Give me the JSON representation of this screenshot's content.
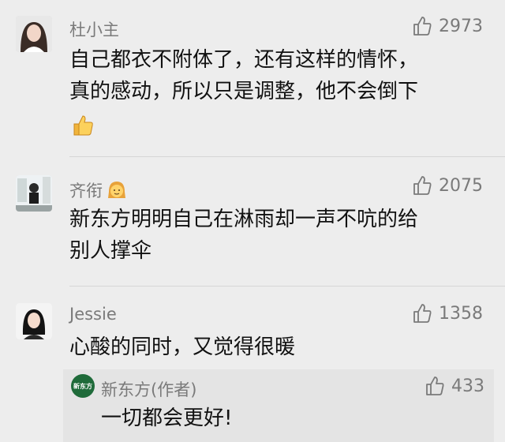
{
  "comments": [
    {
      "name": "杜小主",
      "likes": "2973",
      "line1": "自己都衣不附体了，还有这样的情怀，",
      "line2": "真的感动，所以只是调整，他不会倒下",
      "emoji": "thumbs-up-emoji"
    },
    {
      "name": "齐衔",
      "name_emoji": "girl-face-emoji",
      "likes": "2075",
      "line1": "新东方明明自己在淋雨却一声不吭的给",
      "line2": "别人撑伞"
    },
    {
      "name": "Jessie",
      "likes": "1358",
      "line1": "心酸的同时，又觉得很暖"
    }
  ],
  "reply": {
    "name": "新东方(作者)",
    "logo_text": "新东方",
    "likes": "433",
    "text": "一切都会更好!"
  },
  "colors": {
    "background": "#ededed",
    "name": "#7a7a7a",
    "text": "#111111",
    "reply_background": "#e4e4e4",
    "logo_green": "#1f6b3a"
  }
}
